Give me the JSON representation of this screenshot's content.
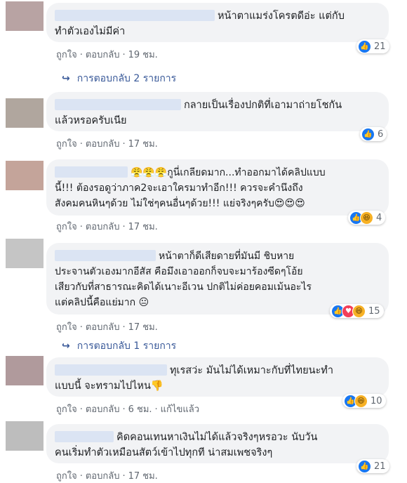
{
  "comments": [
    {
      "text1": "หน้าตาแมร่งโครตดีอ่ะ แต่กับ",
      "text2": "ทำตัวเองไม่มีค่า",
      "like": "ถูกใจ",
      "reply": "ตอบกลับ",
      "time": "19 ชม.",
      "count": "21",
      "avatar_color": "#b8a3a3"
    },
    {
      "text1": "กลายเป็นเรื่องปกติที่เอามาถ่ายโชกัน",
      "text2": "แล้วหรอครับเนีย",
      "like": "ถูกใจ",
      "reply": "ตอบกลับ",
      "time": "17 ชม.",
      "count": "6",
      "avatar_color": "#b0a69e"
    },
    {
      "text1": "😤😤😤กูนี่เกลียดมาก...ทำออกมาได้คลิปแบบ",
      "text2": "นี้!!! ต้องรอดูว่าภาค2จะเอาใครมาทำอีก!!! ควรจะคำนึงถึง",
      "text3": "สังคมคนหินๆด้วย ไม่ใช่ๆคนอื่นๆด้วย!!! แย่จริงๆครับ😍😍😍",
      "like": "ถูกใจ",
      "reply": "ตอบกลับ",
      "time": "17 ชม.",
      "count": "4",
      "avatar_color": "#c4a49a"
    },
    {
      "text1": "หน้าตาก็ดีเสียดายที่มันมี ชิบหาย",
      "text2": "ประจานตัวเองมากอีสัส คือมึงเอาออกก็จบจะมาร้องซีดๆโอ้ย",
      "text3": "เสียวกับที่สาธารณะคิดได้เนาะอีเวน ปกติไม่ค่อยคอมเม้นอะไร",
      "text4": "แต่คลิปนี้คือแย่มาก 😐",
      "like": "ถูกใจ",
      "reply": "ตอบกลับ",
      "time": "17 ชม.",
      "count": "15",
      "avatar_color": "#c5c5c5"
    },
    {
      "text1": "ทุเรสว่ะ มันไม่ได้เหมาะกับที่ไทยนะทำ",
      "text2": "แบบนี้ จะทรามไปไหน👎",
      "like": "ถูกใจ",
      "reply": "ตอบกลับ",
      "time": "6 ชม.",
      "edited": "แก้ไขแล้ว",
      "count": "10",
      "avatar_color": "#b09a9c"
    },
    {
      "text1": "คิดคอนเทนหาเงินไม่ได้แล้วจริงๆหรอวะ นับวัน",
      "text2": "คนเริ่มทำตัวเหมือนสัตว์เข้าไปทุกที น่าสมเพชจริงๆ",
      "like": "ถูกใจ",
      "reply": "ตอบกลับ",
      "time": "17 ชม.",
      "count": "21",
      "avatar_color": "#bdbdbd"
    }
  ],
  "replies_1": "การตอบกลับ 2 รายการ",
  "replies_2": "การตอบกลับ 1 รายการ"
}
